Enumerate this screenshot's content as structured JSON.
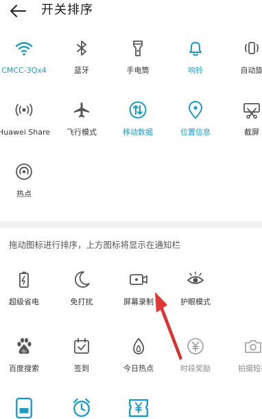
{
  "header": {
    "title": "开关排序"
  },
  "active_tiles": [
    {
      "label": "CMCC-3Qx4",
      "icon": "wifi-icon",
      "state": "on"
    },
    {
      "label": "蓝牙",
      "icon": "bluetooth-icon",
      "state": "off"
    },
    {
      "label": "手电筒",
      "icon": "flashlight-icon",
      "state": "off"
    },
    {
      "label": "响铃",
      "icon": "bell-icon",
      "state": "on"
    },
    {
      "label": "自动旋",
      "icon": "auto-rotate-icon",
      "state": "off"
    },
    {
      "label": "Huawei Share",
      "icon": "huawei-share-icon",
      "state": "off"
    },
    {
      "label": "飞行模式",
      "icon": "airplane-icon",
      "state": "off"
    },
    {
      "label": "移动数据",
      "icon": "mobile-data-icon",
      "state": "on"
    },
    {
      "label": "位置信息",
      "icon": "location-icon",
      "state": "on"
    },
    {
      "label": "截屏",
      "icon": "screenshot-icon",
      "state": "off"
    },
    {
      "label": "热点",
      "icon": "hotspot-icon",
      "state": "off"
    }
  ],
  "hint": "拖动图标进行排序，上方图标将显示在通知栏",
  "inactive_tiles": [
    {
      "label": "超级省电",
      "icon": "battery-saver-icon"
    },
    {
      "label": "免打扰",
      "icon": "moon-icon"
    },
    {
      "label": "屏幕录制",
      "icon": "screen-record-icon"
    },
    {
      "label": "护眼模式",
      "icon": "eye-icon"
    },
    {
      "label": "百度搜索",
      "icon": "baidu-paw-icon"
    },
    {
      "label": "签到",
      "icon": "calendar-check-icon"
    },
    {
      "label": "今日热点",
      "icon": "flame-icon"
    },
    {
      "label": "时段奖励",
      "icon": "yen-coin-icon"
    },
    {
      "label": "拍摄短视",
      "icon": "camera-icon"
    }
  ],
  "colors": {
    "accent": "#1a9bc4",
    "icon_gray": "#555555",
    "arrow": "#e53935",
    "divider": "#f2f2f2"
  }
}
